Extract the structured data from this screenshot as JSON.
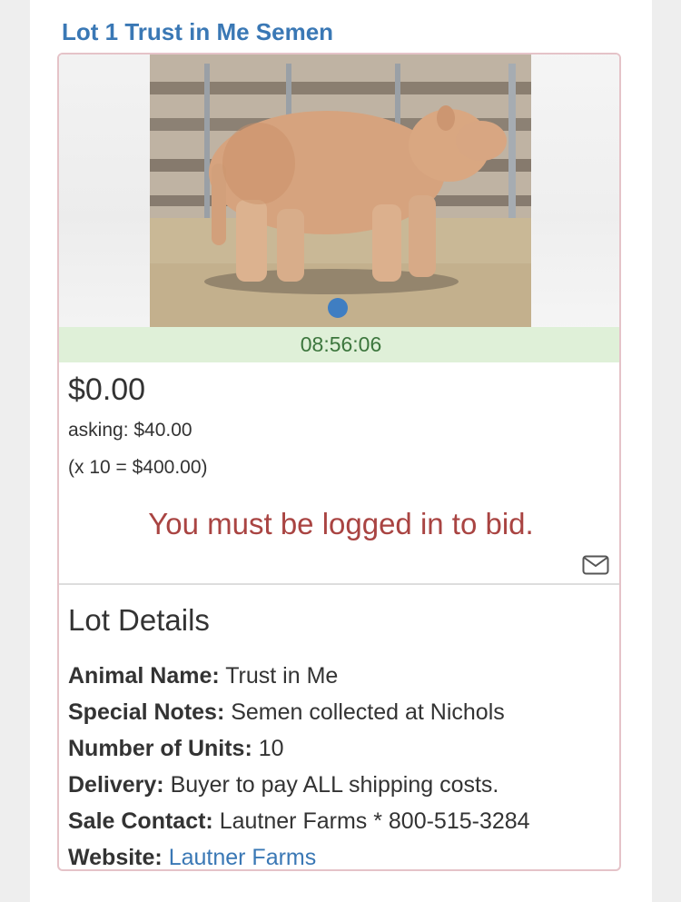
{
  "lot": {
    "title": "Lot 1 Trust in Me Semen"
  },
  "carousel": {
    "image_alt": "Trust in Me steer photo",
    "dot_color": "#3f7ec2"
  },
  "timer": {
    "value": "08:56:06",
    "bg_color": "#dff0d8",
    "text_color": "#3c763d"
  },
  "bidding": {
    "current_price": "$0.00",
    "asking": "asking: $40.00",
    "multiplier": "(x 10 = $400.00)",
    "login_message": "You must be logged in to bid.",
    "message_color": "#a94442"
  },
  "details": {
    "heading": "Lot Details",
    "rows": [
      {
        "label": "Animal Name:",
        "value": " Trust in Me"
      },
      {
        "label": "Special Notes:",
        "value": " Semen collected at Nichols"
      },
      {
        "label": "Number of Units:",
        "value": " 10"
      },
      {
        "label": "Delivery:",
        "value": " Buyer to pay ALL shipping costs."
      },
      {
        "label": "Sale Contact:",
        "value": " Lautner Farms * 800-515-3284"
      },
      {
        "label": "Website:",
        "value": "Lautner Farms"
      }
    ]
  },
  "icons": {
    "mail": "envelope-icon"
  },
  "colors": {
    "accent": "#3a78b5",
    "card_border": "#e5c3c8"
  }
}
